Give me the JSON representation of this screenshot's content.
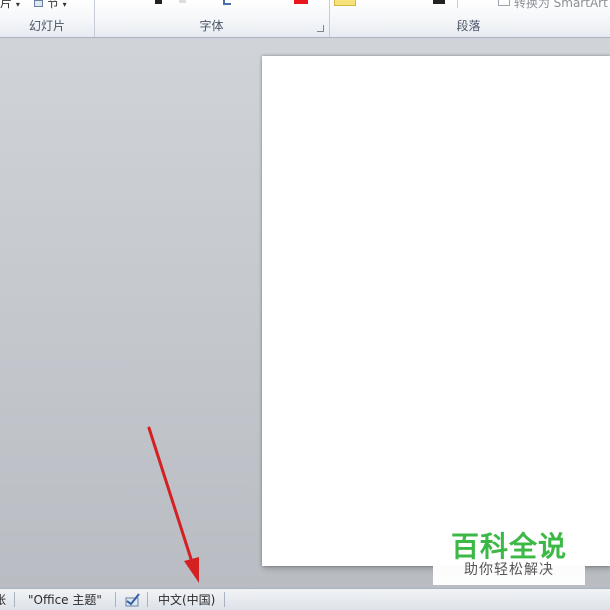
{
  "ribbon": {
    "groups": [
      {
        "label": "幻灯片",
        "button1": "片",
        "button2": "节"
      },
      {
        "label": "字体"
      },
      {
        "label": "段落",
        "button": "转换为 SmartArt"
      }
    ]
  },
  "statusbar": {
    "left_fragment": "张",
    "theme": "\"Office 主题\"",
    "language": "中文(中国)"
  },
  "watermark": {
    "title": "百科全说",
    "subtitle": "助你轻松解决"
  },
  "colors": {
    "font_color_swatch": "#e8161b",
    "highlight_swatch": "#f7e17a",
    "arrow": "#d42020",
    "watermark_green": "#3cb846"
  }
}
